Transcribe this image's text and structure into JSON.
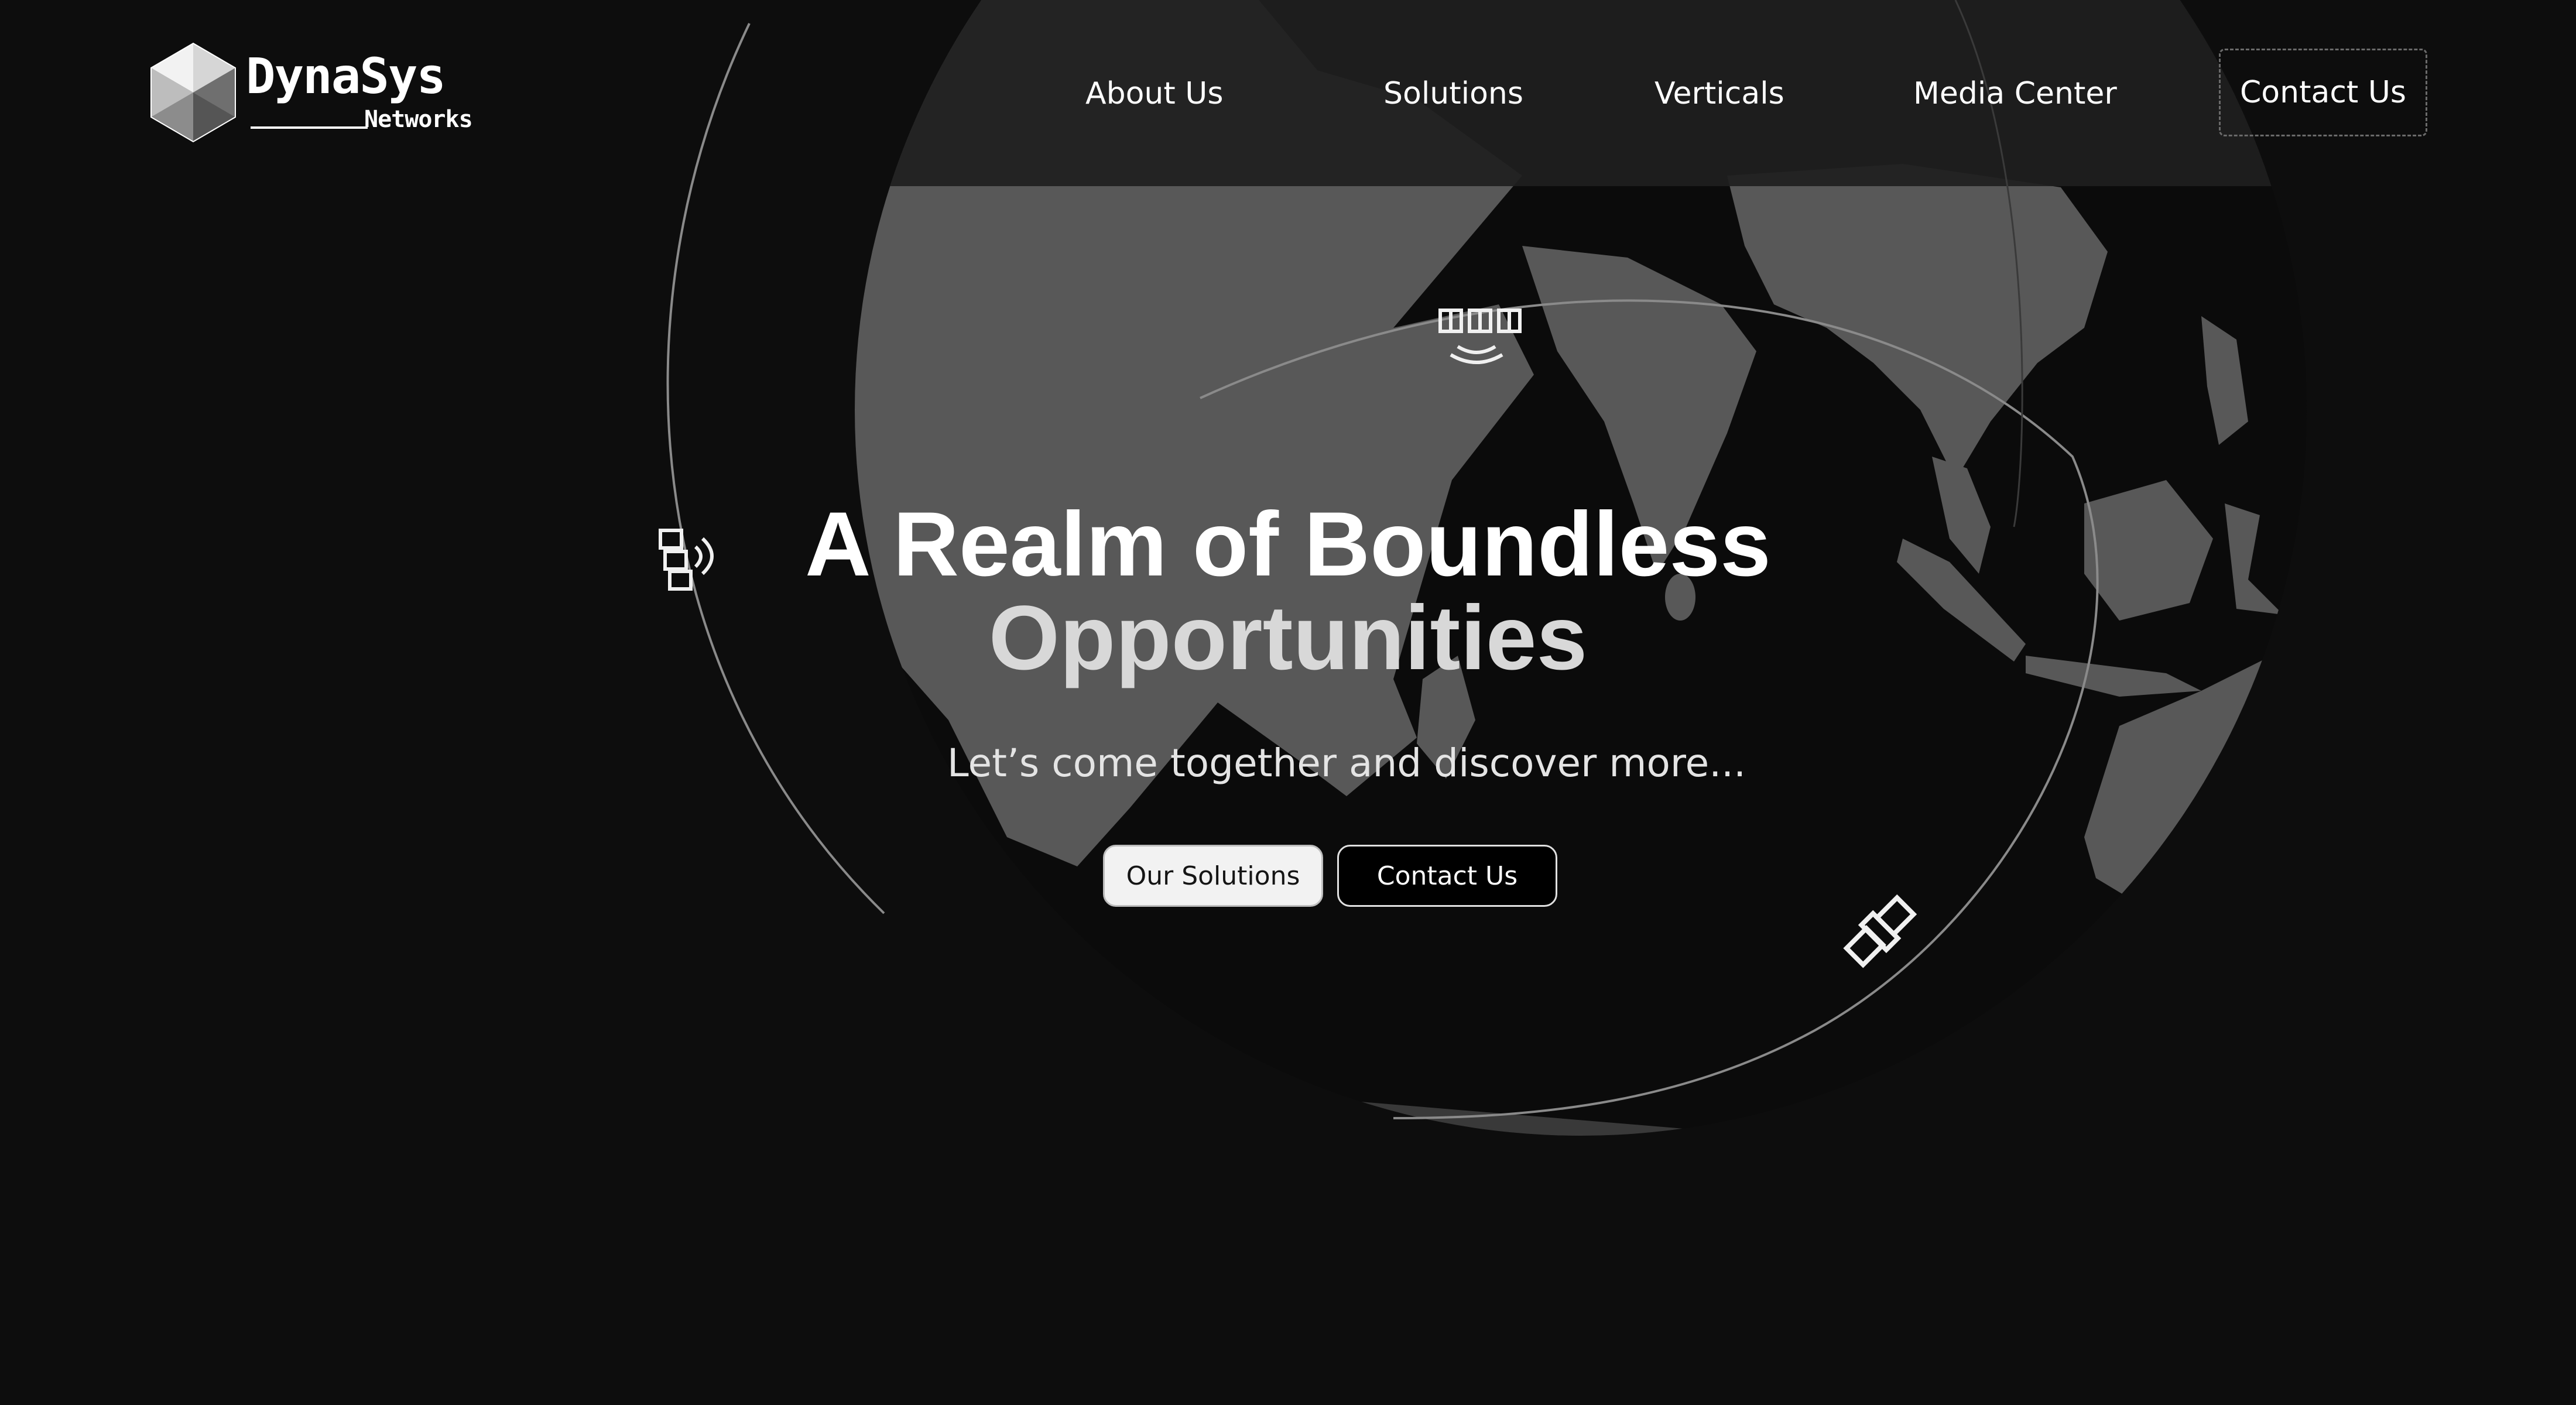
{
  "brand": {
    "name": "DynaSys",
    "subtitle": "Networks"
  },
  "nav": {
    "items": [
      {
        "label": "About Us"
      },
      {
        "label": "Solutions"
      },
      {
        "label": "Verticals"
      },
      {
        "label": "Media Center"
      }
    ],
    "contact_label": "Contact Us"
  },
  "hero": {
    "title_line1": "A Realm of Boundless",
    "title_line2": "Opportunities",
    "subtitle": "Let’s come together and discover more...",
    "primary_button": "Our Solutions",
    "secondary_button": "Contact Us"
  },
  "decor": {
    "globe_icon": "globe-map-icon",
    "satellite_icon": "satellite-icon",
    "colors": {
      "background": "#0d0d0d",
      "land": "#585858",
      "header_band": "#1f1f1f",
      "text": "#ffffff"
    }
  }
}
